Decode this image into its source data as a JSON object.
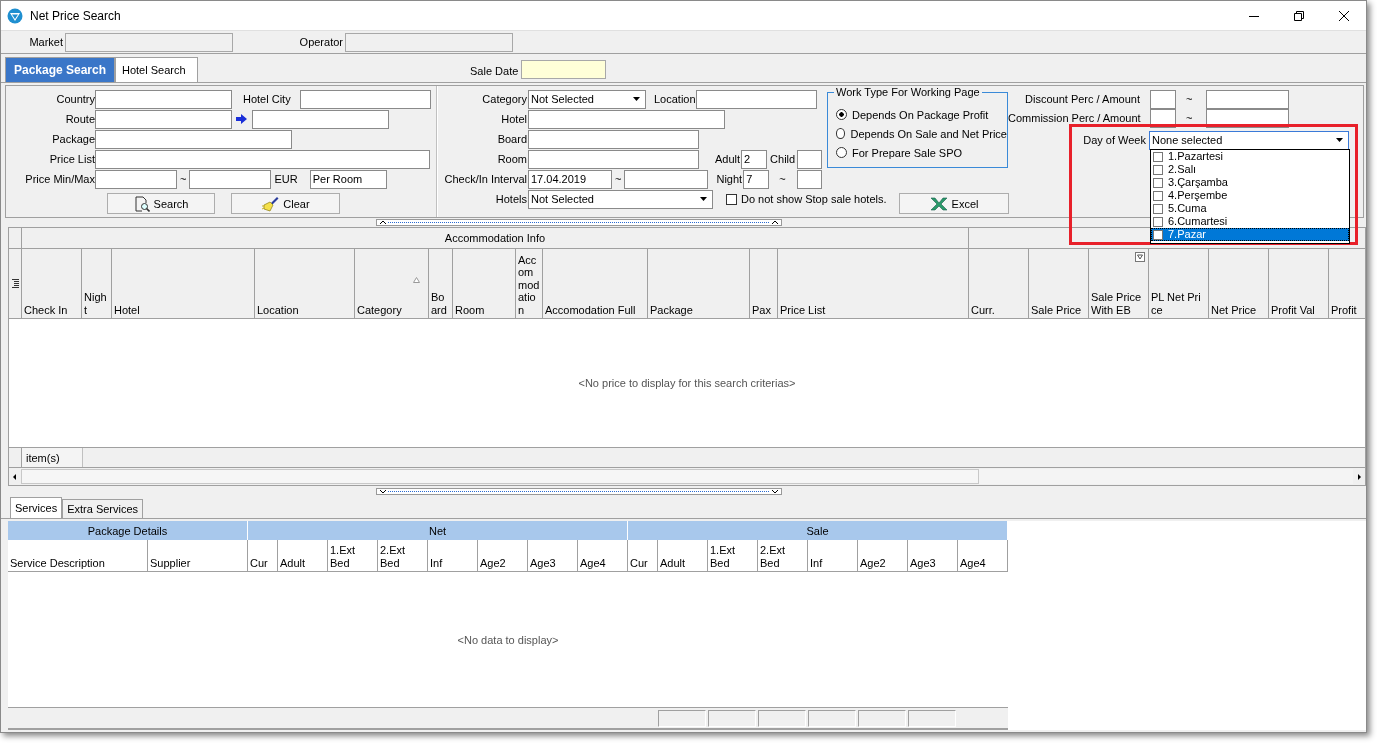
{
  "window": {
    "title": "Net Price Search"
  },
  "header_fields": [
    {
      "label": "Market"
    },
    {
      "label": "Operator"
    }
  ],
  "tabs": [
    {
      "label": "Package Search",
      "selected": true
    },
    {
      "label": "Hotel Search",
      "selected": false
    }
  ],
  "sale_date": {
    "label": "Sale Date"
  },
  "form": {
    "country": "Country",
    "hotel_city": "Hotel City",
    "route": "Route",
    "package": "Package",
    "price_list": "Price List",
    "price_min_max": "Price Min/Max",
    "price_sep": "~",
    "currency": "EUR",
    "price_basis": "Per Room",
    "search_button": "Search",
    "clear_button": "Clear",
    "category": {
      "label": "Category",
      "value": "Not Selected"
    },
    "location": "Location",
    "hotel": "Hotel",
    "board": "Board",
    "room": "Room",
    "adult": {
      "label": "Adult",
      "value": "2"
    },
    "child": "Child",
    "check_in": {
      "label": "Check/In Interval",
      "value": "17.04.2019",
      "sep": "~"
    },
    "night": {
      "label": "Night",
      "value": "7",
      "sep": "~"
    },
    "hotels": {
      "label": "Hotels",
      "value": "Not Selected"
    },
    "stop_sale": {
      "label": "Do not show Stop sale hotels.",
      "checked": false
    }
  },
  "work_type": {
    "title": "Work Type For Working Page",
    "options": [
      {
        "label": "Depends On Package Profit",
        "selected": true
      },
      {
        "label": "Depends On Sale and Net Price",
        "selected": false
      },
      {
        "label": "For Prepare Sale SPO",
        "selected": false
      }
    ]
  },
  "excel_button": "Excel",
  "discount": {
    "label": "Discount Perc / Amount",
    "sep": "~"
  },
  "commission": {
    "label": "Commission Perc / Amount",
    "sep": "~"
  },
  "day_of_week": {
    "label": "Day of Week",
    "value": "None selected",
    "options": [
      {
        "label": "1.Pazartesi",
        "checked": false,
        "selected": false
      },
      {
        "label": "2.Salı",
        "checked": false,
        "selected": false
      },
      {
        "label": "3.Çarşamba",
        "checked": false,
        "selected": false
      },
      {
        "label": "4.Perşembe",
        "checked": false,
        "selected": false
      },
      {
        "label": "5.Cuma",
        "checked": false,
        "selected": false
      },
      {
        "label": "6.Cumartesi",
        "checked": false,
        "selected": false
      },
      {
        "label": "7.Pazar",
        "checked": false,
        "selected": true
      }
    ]
  },
  "results": {
    "group_header": "Accommodation Info",
    "columns": [
      {
        "label": "Check In",
        "sorted": false,
        "filter": false
      },
      {
        "label": "Night",
        "sorted": false,
        "filter": false
      },
      {
        "label": "Hotel",
        "sorted": false,
        "filter": false
      },
      {
        "label": "Location",
        "sorted": false,
        "filter": false
      },
      {
        "label": "Category",
        "sorted": true,
        "filter": false
      },
      {
        "label": "Board",
        "sorted": false,
        "filter": false
      },
      {
        "label": "Room",
        "sorted": false,
        "filter": false
      },
      {
        "label": "Accommodation",
        "sorted": false,
        "filter": false
      },
      {
        "label": "Accomodation Full",
        "sorted": false,
        "filter": false
      },
      {
        "label": "Package",
        "sorted": false,
        "filter": false
      },
      {
        "label": "Pax",
        "sorted": false,
        "filter": false
      },
      {
        "label": "Price List",
        "sorted": false,
        "filter": false
      },
      {
        "label": "Curr.",
        "sorted": false,
        "filter": false
      },
      {
        "label": "Sale Price",
        "sorted": false,
        "filter": false
      },
      {
        "label": "Sale Price With EB",
        "sorted": false,
        "filter": true
      },
      {
        "label": "PL Net Price",
        "sorted": false,
        "filter": false
      },
      {
        "label": "Net Price",
        "sorted": false,
        "filter": false
      },
      {
        "label": "Profit Val",
        "sorted": false,
        "filter": false
      },
      {
        "label": "Profit",
        "sorted": false,
        "filter": false
      }
    ],
    "empty_text": "<No price to display for this search criterias>",
    "footer": "item(s)"
  },
  "bottom_tabs": [
    {
      "label": "Services",
      "selected": true
    },
    {
      "label": "Extra Services",
      "selected": false
    }
  ],
  "services": {
    "bands": [
      {
        "label": "Package Details",
        "columns": [
          "Service Description",
          "Supplier"
        ]
      },
      {
        "label": "Net",
        "columns": [
          "Cur",
          "Adult",
          "1.Ext Bed",
          "2.Ext Bed",
          "Inf",
          "Age2",
          "Age3",
          "Age4"
        ]
      },
      {
        "label": "Sale",
        "columns": [
          "Cur",
          "Adult",
          "1.Ext Bed",
          "2.Ext Bed",
          "Inf",
          "Age2",
          "Age3",
          "Age4"
        ]
      }
    ],
    "empty_text": "<No data to display>"
  }
}
